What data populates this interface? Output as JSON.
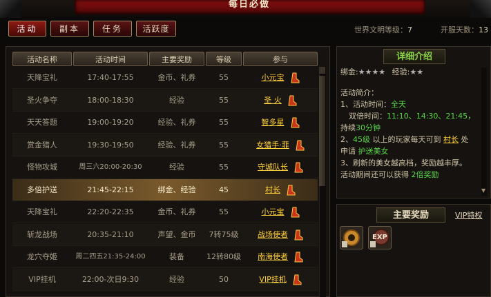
{
  "window": {
    "title": "每日必做"
  },
  "tabs": [
    {
      "label": "活动",
      "active": true
    },
    {
      "label": "副本",
      "active": false
    },
    {
      "label": "任务",
      "active": false
    },
    {
      "label": "活跃度",
      "active": false
    }
  ],
  "status": {
    "world_level_label": "世界文明等级：",
    "world_level_value": "7",
    "server_days_label": "开服天数：",
    "server_days_value": "13"
  },
  "table": {
    "headers": [
      "活动名称",
      "活动时间",
      "主要奖励",
      "等级",
      "参与"
    ],
    "rows": [
      {
        "name": "天降宝礼",
        "time": "17:40-17:55",
        "reward": "金币、礼券",
        "level": "55",
        "join": "小元宝"
      },
      {
        "name": "圣火争夺",
        "time": "18:00-18:30",
        "reward": "经验",
        "level": "55",
        "join": "圣 火"
      },
      {
        "name": "天天答题",
        "time": "19:00-19:20",
        "reward": "经验、礼券",
        "level": "55",
        "join": "智多星"
      },
      {
        "name": "赏金猎人",
        "time": "19:30-19:50",
        "reward": "经验、礼券",
        "level": "55",
        "join": "女猎手·菲"
      },
      {
        "name": "怪物攻城",
        "time": "周三六20:00-20:30",
        "reward": "经验",
        "level": "55",
        "join": "守城队长"
      },
      {
        "name": "多倍护送",
        "time": "21:45-22:15",
        "reward": "绑金、经验",
        "level": "45",
        "join": "村长"
      },
      {
        "name": "天降宝礼",
        "time": "22:20-22:35",
        "reward": "金币、礼券",
        "level": "55",
        "join": "小元宝"
      },
      {
        "name": "斩龙战场",
        "time": "20:35-21:10",
        "reward": "声望、金币",
        "level": "7转75级",
        "join": "战场使者"
      },
      {
        "name": "龙穴夺姬",
        "time": "周二四五21:35-24:00",
        "reward": "装备",
        "level": "12转80级",
        "join": "南海使者"
      },
      {
        "name": "VIP挂机",
        "time": "22:00-次日9:30",
        "reward": "经验",
        "level": "50",
        "join": "VIP挂机"
      }
    ]
  },
  "detail": {
    "title": "详细介绍",
    "bind_gold_label": "绑金:",
    "bind_gold_stars": "★★★★",
    "exp_label": "经验:",
    "exp_stars": "★★",
    "intro_label": "活动简介：",
    "l1_pre": "1、活动时间：",
    "l1_val": "全天",
    "l2_pre": "双倍时间：",
    "l2_val": "11:10、14:30、21:45，",
    "l3_pre": "持续",
    "l3_val": "30分钟",
    "l4_n": "2、",
    "l4_lv": "45级",
    "l4_mid": " 以上的玩家每天可到 ",
    "l4_npc": "村长",
    "l4_end": " 处",
    "l5_pre": "申请 ",
    "l5_val": "护送美女",
    "l6": "3、刷新的美女越高档，奖励越丰厚。",
    "l7_pre": "活动期间还可以获得 ",
    "l7_val": "2倍奖励"
  },
  "rewards": {
    "title": "主要奖励",
    "vip_label": "VIP特权",
    "items": [
      {
        "icon": "bind-gold-icon"
      },
      {
        "icon": "exp-icon",
        "text": "EXP"
      }
    ]
  },
  "colors": {
    "accent_gold": "#ffd23a",
    "accent_green": "#5ad848",
    "tab_red": "#8e1a14"
  }
}
